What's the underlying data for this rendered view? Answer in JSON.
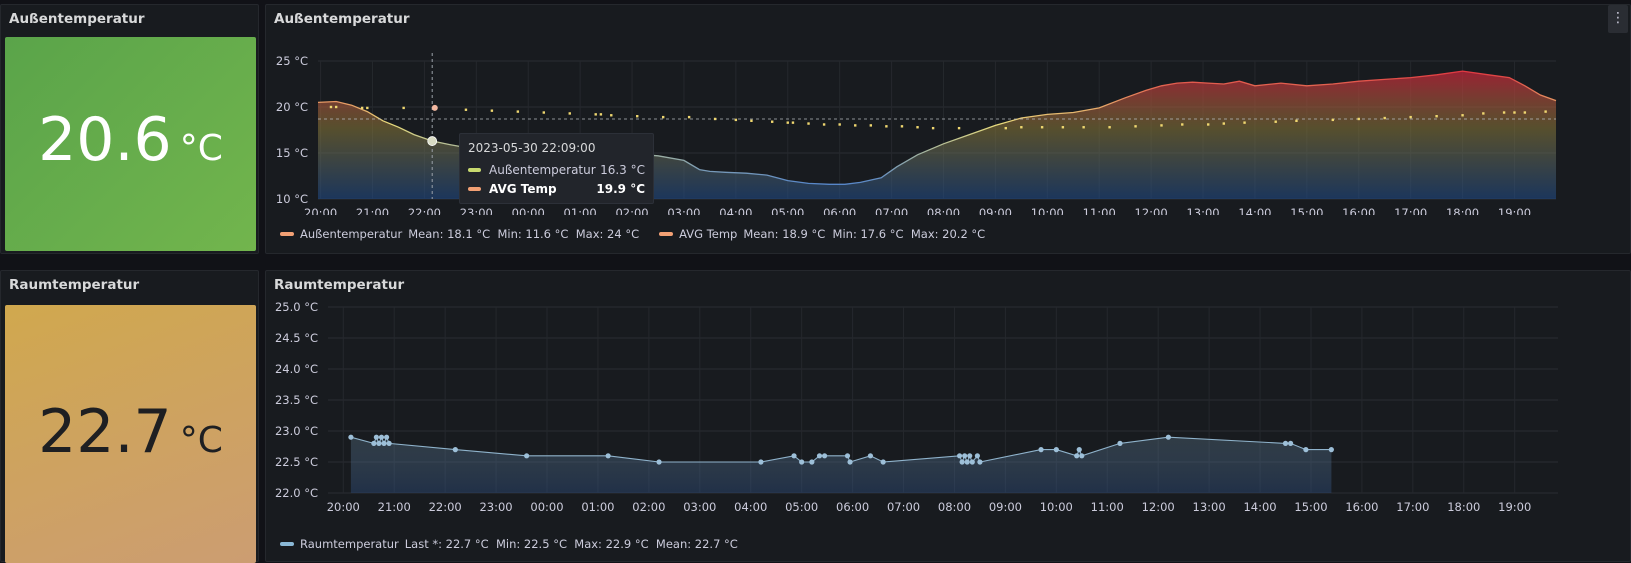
{
  "panels": {
    "outdoor_stat": {
      "title": "Außentemperatur",
      "value": "20.6",
      "unit": "°C"
    },
    "outdoor_chart": {
      "title": "Außentemperatur"
    },
    "room_stat": {
      "title": "Raumtemperatur",
      "value": "22.7",
      "unit": "°C"
    },
    "room_chart": {
      "title": "Raumtemperatur"
    }
  },
  "tooltip": {
    "time": "2023-05-30 22:09:00",
    "rows": [
      {
        "name": "Außentemperatur",
        "value": "16.3 °C",
        "color": "#c8d96f"
      },
      {
        "name": "AVG Temp",
        "value": "19.9 °C",
        "color": "#f2a074"
      }
    ]
  },
  "legend_outdoor": [
    {
      "name": "Außentemperatur",
      "stats": "Mean: 18.1 °C  Min: 11.6 °C  Max: 24 °C",
      "color": "#f2a074"
    },
    {
      "name": "AVG Temp",
      "stats": "Mean: 18.9 °C  Min: 17.6 °C  Max: 20.2 °C",
      "color": "#f2a074"
    }
  ],
  "legend_room": [
    {
      "name": "Raumtemperatur",
      "stats": "Last *: 22.7 °C  Min: 22.5 °C  Max: 22.9 °C  Mean: 22.7 °C",
      "color": "#8ab8d6"
    }
  ],
  "colors": {
    "stat_green": "#63a94a",
    "stat_orange": "#d4a35e",
    "room_line": "#8fb3cc",
    "avg_dots": "#f2e27a"
  },
  "chart_data": [
    {
      "type": "area",
      "title": "",
      "ylim": [
        10,
        25
      ],
      "y_ticks": [
        10,
        15,
        20,
        25
      ],
      "y_tick_labels": [
        "10 °C",
        "15 °C",
        "20 °C",
        "25 °C"
      ],
      "x_labels": [
        "20:00",
        "21:00",
        "22:00",
        "23:00",
        "00:00",
        "01:00",
        "02:00",
        "03:00",
        "04:00",
        "05:00",
        "06:00",
        "07:00",
        "08:00",
        "09:00",
        "10:00",
        "11:00",
        "12:00",
        "13:00",
        "14:00",
        "15:00",
        "16:00",
        "17:00",
        "18:00",
        "19:00"
      ],
      "x_range_hours": [
        19.95,
        43.8
      ],
      "threshold": 18.7,
      "series": [
        {
          "name": "Außentemperatur",
          "x": [
            19.95,
            20.3,
            20.6,
            20.9,
            21.2,
            21.5,
            21.8,
            22.15,
            22.5,
            22.8,
            23.1,
            23.4,
            23.7,
            24,
            24.5,
            25,
            25.5,
            26,
            26.5,
            27,
            27.3,
            27.5,
            27.8,
            28.2,
            28.6,
            29,
            29.4,
            29.8,
            30.1,
            30.4,
            30.8,
            31.1,
            31.5,
            32,
            32.5,
            33,
            33.5,
            34,
            34.5,
            35,
            35.5,
            35.9,
            36.2,
            36.5,
            36.8,
            37.1,
            37.4,
            37.7,
            38,
            38.5,
            39,
            39.5,
            40,
            40.5,
            41,
            41.5,
            42,
            42.5,
            42.9,
            43.2,
            43.5,
            43.8
          ],
          "y": [
            20.5,
            20.6,
            20.2,
            19.5,
            18.5,
            17.8,
            17.0,
            16.3,
            15.9,
            15.6,
            15.2,
            15.1,
            15.0,
            15.0,
            14.9,
            14.8,
            14.8,
            14.9,
            14.7,
            14.2,
            13.2,
            13.0,
            12.9,
            12.8,
            12.6,
            12.0,
            11.7,
            11.6,
            11.6,
            11.8,
            12.3,
            13.5,
            14.8,
            16.0,
            17.0,
            18.0,
            18.8,
            19.2,
            19.4,
            19.9,
            21.0,
            21.8,
            22.3,
            22.6,
            22.7,
            22.6,
            22.5,
            22.8,
            22.3,
            22.6,
            22.3,
            22.5,
            22.8,
            23.0,
            23.2,
            23.5,
            23.9,
            23.5,
            23.2,
            22.3,
            21.3,
            20.7
          ]
        },
        {
          "name": "AVG Temp",
          "x": [
            20.2,
            20.3,
            20.8,
            20.9,
            21.6,
            22.2,
            22.8,
            23.3,
            23.8,
            24.3,
            24.8,
            25.3,
            25.4,
            25.6,
            26.1,
            26.6,
            27.1,
            27.6,
            28,
            28.3,
            28.7,
            29,
            29.1,
            29.4,
            29.7,
            30,
            30.3,
            30.6,
            30.9,
            31.2,
            31.5,
            31.8,
            32.3,
            33.2,
            33.5,
            33.9,
            34.3,
            34.7,
            35.2,
            35.7,
            36.2,
            36.6,
            37.1,
            37.4,
            37.8,
            38.4,
            38.8,
            39.5,
            40,
            40.5,
            41,
            41.5,
            42,
            42.4,
            42.8,
            43,
            43.2,
            43.6
          ],
          "y": [
            20.0,
            20.0,
            19.9,
            19.9,
            19.9,
            19.9,
            19.7,
            19.6,
            19.5,
            19.4,
            19.3,
            19.2,
            19.2,
            19.1,
            19.0,
            18.9,
            18.9,
            18.7,
            18.6,
            18.5,
            18.4,
            18.3,
            18.3,
            18.2,
            18.1,
            18.1,
            18.0,
            18.0,
            17.9,
            17.9,
            17.8,
            17.7,
            17.7,
            17.7,
            17.8,
            17.8,
            17.8,
            17.8,
            17.8,
            17.9,
            18.0,
            18.1,
            18.1,
            18.2,
            18.3,
            18.4,
            18.5,
            18.6,
            18.7,
            18.8,
            18.9,
            19.0,
            19.1,
            19.3,
            19.4,
            19.4,
            19.4,
            19.5
          ]
        }
      ]
    },
    {
      "type": "line",
      "title": "",
      "ylim": [
        22.0,
        25.0
      ],
      "y_ticks": [
        22.0,
        22.5,
        23.0,
        23.5,
        24.0,
        24.5,
        25.0
      ],
      "y_tick_labels": [
        "22.0 °C",
        "22.5 °C",
        "23.0 °C",
        "23.5 °C",
        "24.0 °C",
        "24.5 °C",
        "25.0 °C"
      ],
      "x_labels": [
        "20:00",
        "21:00",
        "22:00",
        "23:00",
        "00:00",
        "01:00",
        "02:00",
        "03:00",
        "04:00",
        "05:00",
        "06:00",
        "07:00",
        "08:00",
        "09:00",
        "10:00",
        "11:00",
        "12:00",
        "13:00",
        "14:00",
        "15:00",
        "16:00",
        "17:00",
        "18:00",
        "19:00"
      ],
      "x_range_hours": [
        19.7,
        43.85
      ],
      "series": [
        {
          "name": "Raumtemperatur",
          "x": [
            20.15,
            20.6,
            20.65,
            20.7,
            20.75,
            20.8,
            20.85,
            20.9,
            22.2,
            23.6,
            25.2,
            26.2,
            28.2,
            28.85,
            29,
            29.2,
            29.35,
            29.45,
            29.9,
            29.95,
            30.35,
            30.6,
            32.1,
            32.15,
            32.2,
            32.25,
            32.3,
            32.35,
            32.45,
            32.5,
            33.7,
            34,
            34.4,
            34.45,
            34.5,
            35.25,
            36.2,
            38.5,
            38.6,
            38.9,
            39.4
          ],
          "y": [
            22.9,
            22.8,
            22.9,
            22.8,
            22.9,
            22.8,
            22.9,
            22.8,
            22.7,
            22.6,
            22.6,
            22.5,
            22.5,
            22.6,
            22.5,
            22.5,
            22.6,
            22.6,
            22.6,
            22.5,
            22.6,
            22.5,
            22.6,
            22.5,
            22.6,
            22.5,
            22.6,
            22.5,
            22.6,
            22.5,
            22.7,
            22.7,
            22.6,
            22.7,
            22.6,
            22.8,
            22.9,
            22.8,
            22.8,
            22.7,
            22.7
          ]
        }
      ]
    }
  ]
}
